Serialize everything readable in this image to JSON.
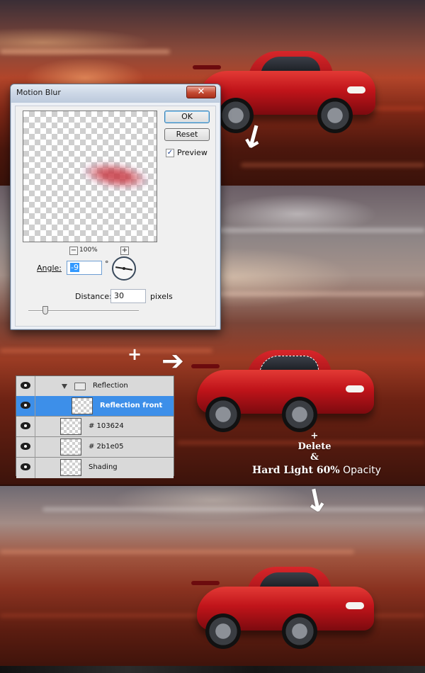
{
  "dialog": {
    "title": "Motion Blur",
    "close_glyph": "✕",
    "ok_label": "OK",
    "reset_label": "Reset",
    "preview_label": "Preview",
    "preview_checked": "✓",
    "zoom_minus": "−",
    "zoom_plus": "+",
    "zoom_level": "100%",
    "angle_label": "Angle:",
    "angle_value": "-9",
    "degree_symbol": "°",
    "distance_label": "Distance:",
    "distance_value": "30",
    "distance_unit": "pixels"
  },
  "layers": {
    "rows": [
      {
        "label": "Reflection",
        "type": "group"
      },
      {
        "label": "Reflection front",
        "type": "layer",
        "selected": true
      },
      {
        "label": "# 103624",
        "type": "layer"
      },
      {
        "label": "# 2b1e05",
        "type": "layer"
      },
      {
        "label": "Shading",
        "type": "layer"
      }
    ]
  },
  "annotations": {
    "plus_top": "+",
    "plus_note": "+",
    "delete": "Delete",
    "ampersand": "&",
    "hard_light": "Hard Light 60%",
    "opacity": " Opacity"
  },
  "icons": {
    "arrow_top": "arrow-down-left-icon",
    "arrow_mid": "arrow-right-icon",
    "arrow_bottom": "arrow-down-icon",
    "eye": "eye-icon",
    "folder": "folder-icon"
  },
  "colors": {
    "car_red": "#c0141a",
    "selection_blue": "#3d8fe9",
    "dialog_bg": "#ecf0f6"
  }
}
